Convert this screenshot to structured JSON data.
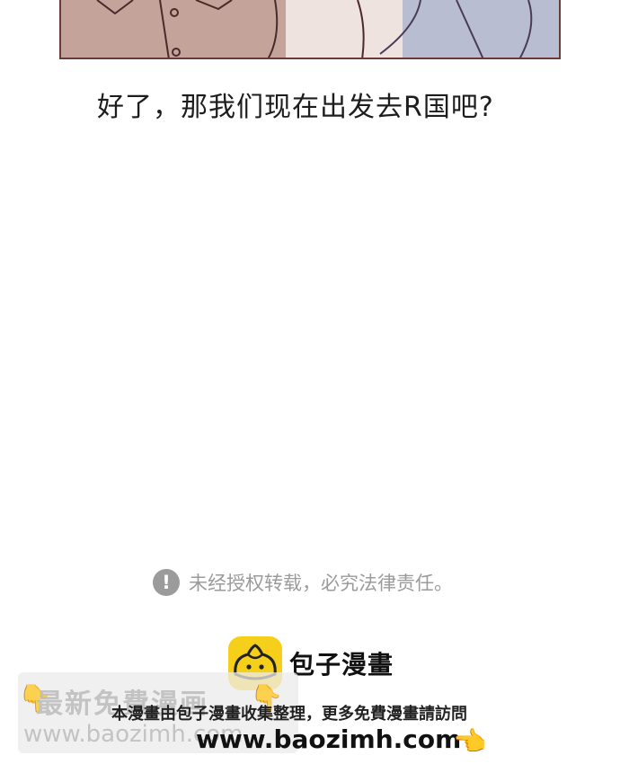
{
  "dialogue": "好了，那我们现在出发去R国吧?",
  "notice": {
    "icon": "exclamation-circle-icon",
    "text": "未经授权转载，必究法律责任。"
  },
  "brand": {
    "logo": "baozi-logo-icon",
    "name": "包子漫畫"
  },
  "source_line": "本漫畫由包子漫畫收集整理，更多免費漫畫請訪問",
  "url": "www.baozimh.com",
  "watermark": {
    "line1": "最新免費漫画",
    "line2": "www.baozimh.com"
  },
  "colors": {
    "logo_bg": "#f6cf1a",
    "notice_gray": "#9b9b9b",
    "panel_border": "#6b3b3a"
  }
}
